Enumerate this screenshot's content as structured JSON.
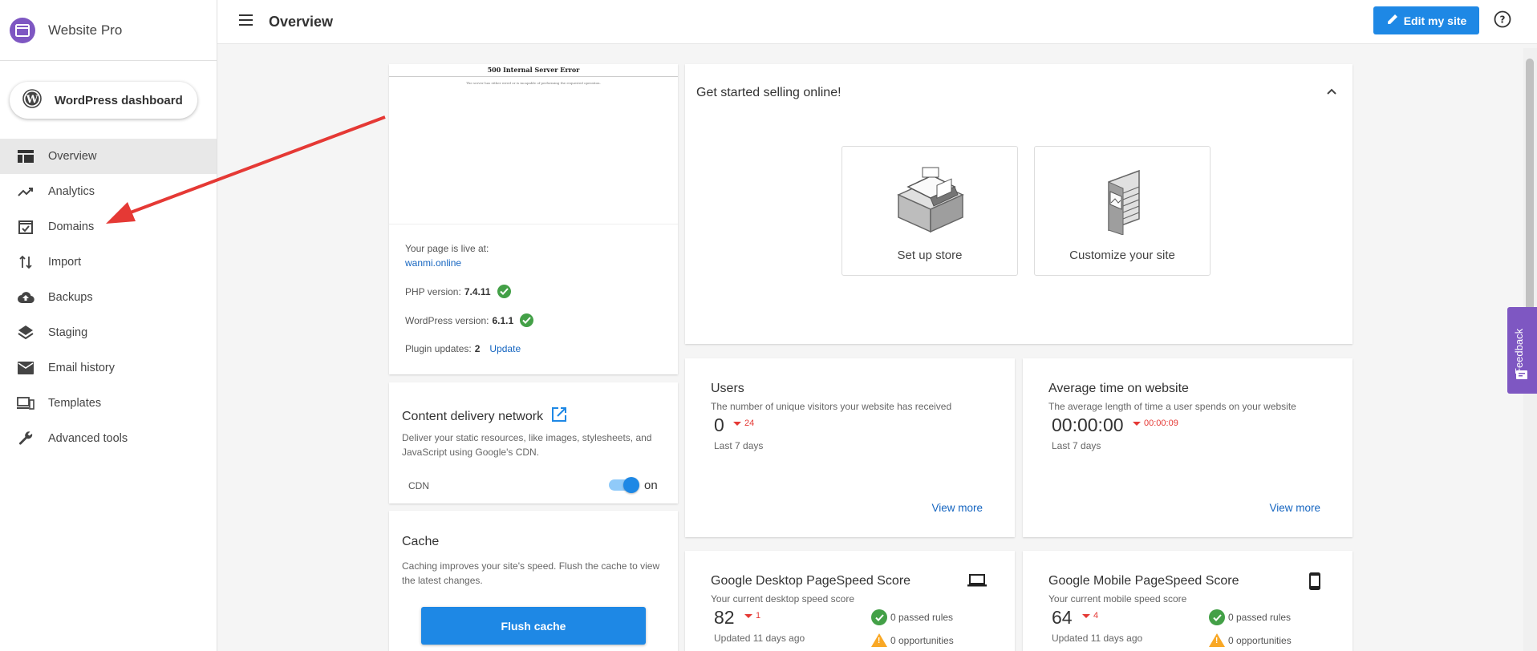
{
  "brand": {
    "name": "Website Pro",
    "color": "#7e57c2"
  },
  "sidebar": {
    "wp_button_label": "WordPress dashboard",
    "items": [
      {
        "label": "Overview",
        "icon": "overview-icon",
        "active": true
      },
      {
        "label": "Analytics",
        "icon": "trending-up-icon"
      },
      {
        "label": "Domains",
        "icon": "domains-check-icon"
      },
      {
        "label": "Import",
        "icon": "import-arrows-icon"
      },
      {
        "label": "Backups",
        "icon": "cloud-upload-icon"
      },
      {
        "label": "Staging",
        "icon": "layers-icon"
      },
      {
        "label": "Email history",
        "icon": "email-icon"
      },
      {
        "label": "Templates",
        "icon": "devices-icon"
      },
      {
        "label": "Advanced tools",
        "icon": "wrench-icon"
      }
    ]
  },
  "header": {
    "title": "Overview",
    "edit_label": "Edit my site",
    "accent": "#1e88e5"
  },
  "preview": {
    "error_title": "500 Internal Server Error",
    "error_message": "The server has either erred or is incapable of performing the requested operation.",
    "live_label": "Your page is live at:",
    "live_url": "wanmi.online",
    "php_label": "PHP version:",
    "php_version": "7.4.11",
    "wp_label": "WordPress version:",
    "wp_version": "6.1.1",
    "plugin_label": "Plugin updates:",
    "plugin_count": "2",
    "update_label": "Update"
  },
  "cdn": {
    "title": "Content delivery network",
    "desc": "Deliver your static resources, like images, stylesheets, and JavaScript using Google's CDN.",
    "label": "CDN",
    "state": "on"
  },
  "cache": {
    "title": "Cache",
    "desc": "Caching improves your site's speed. Flush the cache to view the latest changes.",
    "button": "Flush cache"
  },
  "sell": {
    "title": "Get started selling online!",
    "options": [
      {
        "label": "Set up store",
        "icon": "store-illustration-icon"
      },
      {
        "label": "Customize your site",
        "icon": "site-layout-illustration-icon"
      }
    ]
  },
  "users": {
    "title": "Users",
    "desc": "The number of unique visitors your website has received",
    "value": "0",
    "delta": "24",
    "period": "Last 7 days",
    "link": "View more"
  },
  "avg_time": {
    "title": "Average time on website",
    "desc": "The average length of time a user spends on your website",
    "value": "00:00:00",
    "delta": "00:00:09",
    "period": "Last 7 days",
    "link": "View more"
  },
  "desktop_speed": {
    "title": "Google Desktop PageSpeed Score",
    "desc": "Your current desktop speed score",
    "value": "82",
    "delta": "1",
    "updated": "Updated 11 days ago",
    "passed": "0 passed rules",
    "opportunities": "0 opportunities"
  },
  "mobile_speed": {
    "title": "Google Mobile PageSpeed Score",
    "desc": "Your current mobile speed score",
    "value": "64",
    "delta": "4",
    "updated": "Updated 11 days ago",
    "passed": "0 passed rules",
    "opportunities": "0 opportunities"
  },
  "feedback_label": "Feedback"
}
